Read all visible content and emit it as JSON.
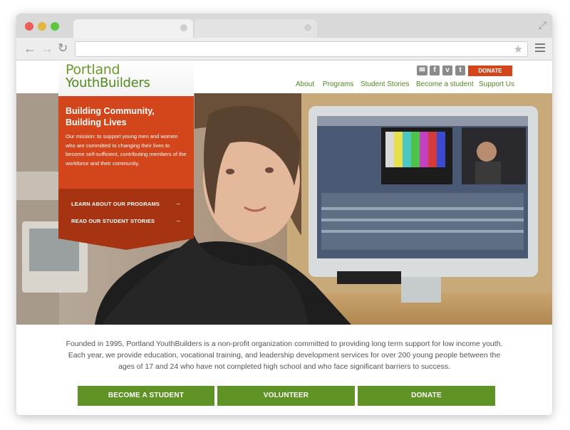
{
  "site": {
    "logo_line1": "Portland",
    "logo_line2": "YouthBuilders",
    "donate_label": "DONATE",
    "social": {
      "mail": "✉",
      "facebook": "f",
      "vimeo": "v",
      "twitter": "t"
    },
    "nav": [
      "About",
      "Programs",
      "Student Stories",
      "Become a student",
      "Support Us"
    ]
  },
  "hero": {
    "title_line1": "Building Community,",
    "title_line2": "Building Lives",
    "mission": "Our mission: to support young men and women who are committed to changing their lives to become self-sufficient, contributing members of the workforce and their community.",
    "links": [
      "LEARN ABOUT OUR PROGRAMS",
      "READ OUR STUDENT STORIES"
    ],
    "arrow": "→"
  },
  "about": {
    "text": "Founded in 1995, Portland YouthBuilders is a non-profit organization committed to providing long term support for low income youth.  Each year, we provide education, vocational training, and leadership development services for over 200 young people between the ages of 17 and 24 who have not completed high school and who face significant barriers to success."
  },
  "cta": {
    "become": "BECOME A STUDENT",
    "volunteer": "VOLUNTEER",
    "donate": "DONATE"
  },
  "colors": {
    "brand_green": "#5f9325",
    "brand_orange": "#d3451a",
    "brand_dark_orange": "#a63312"
  }
}
